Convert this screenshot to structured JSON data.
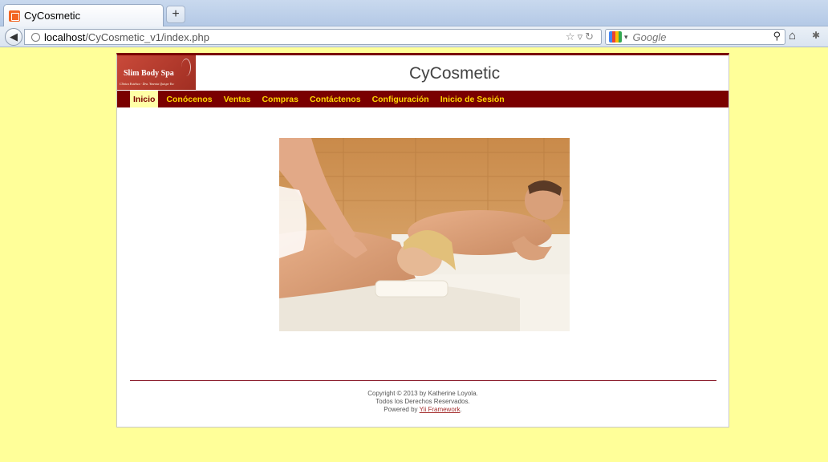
{
  "browser": {
    "tab_title": "CyCosmetic",
    "new_tab": "+",
    "url_host": "localhost",
    "url_path": "/CyCosmetic_v1/index.php",
    "search_placeholder": "Google"
  },
  "site": {
    "logo_title": "Slim Body Spa",
    "logo_subtitle": "Clínica Estética · Dra. Yesenia Quispe Yoc",
    "title": "CyCosmetic",
    "menu": [
      {
        "label": "Inicio",
        "active": true
      },
      {
        "label": "Conócenos"
      },
      {
        "label": "Ventas"
      },
      {
        "label": "Compras"
      },
      {
        "label": "Contáctenos"
      },
      {
        "label": "Configuración"
      },
      {
        "label": "Inicio de Sesión"
      }
    ]
  },
  "footer": {
    "copyright": "Copyright © 2013 by Katherine Loyola.",
    "rights": "Todos los Derechos Reservados.",
    "powered_prefix": "Powered by ",
    "powered_link": "Yii Framework",
    "powered_suffix": "."
  },
  "colors": {
    "page_bg": "#ffff99",
    "menu_bg": "#7a0000",
    "menu_text": "#ffd700",
    "active_bg": "#ffffa6"
  }
}
